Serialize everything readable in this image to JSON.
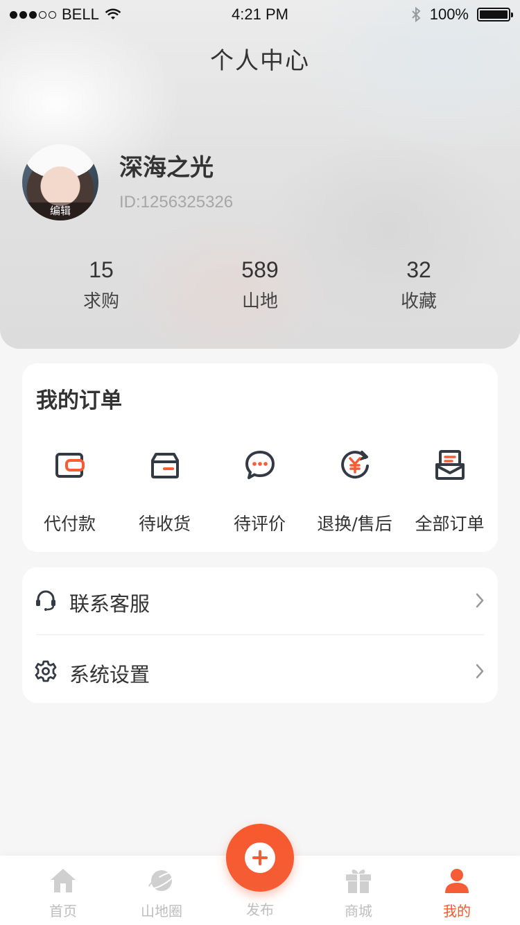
{
  "status_bar": {
    "carrier": "BELL",
    "time": "4:21 PM",
    "battery": "100%"
  },
  "page_title": "个人中心",
  "user": {
    "name": "深海之光",
    "id": "ID:1256325326",
    "avatar_edit": "编辑"
  },
  "stats": [
    {
      "value": "15",
      "label": "求购"
    },
    {
      "value": "589",
      "label": "山地"
    },
    {
      "value": "32",
      "label": "收藏"
    }
  ],
  "orders": {
    "title": "我的订单",
    "items": [
      {
        "label": "代付款",
        "icon": "wallet-icon"
      },
      {
        "label": "待收货",
        "icon": "package-icon"
      },
      {
        "label": "待评价",
        "icon": "comment-icon"
      },
      {
        "label": "退换/售后",
        "icon": "refund-icon"
      },
      {
        "label": "全部订单",
        "icon": "order-list-icon"
      }
    ]
  },
  "menu": [
    {
      "label": "联系客服",
      "icon": "headset-icon"
    },
    {
      "label": "系统设置",
      "icon": "gear-icon"
    }
  ],
  "tabbar": {
    "items": [
      {
        "label": "首页",
        "icon": "home-icon"
      },
      {
        "label": "山地圈",
        "icon": "planet-icon"
      },
      {
        "label": "发布",
        "icon": "plus-icon"
      },
      {
        "label": "商城",
        "icon": "gift-icon"
      },
      {
        "label": "我的",
        "icon": "user-icon"
      }
    ],
    "active": "我的"
  },
  "colors": {
    "accent": "#f45d35",
    "icon_dark": "#333a44",
    "inactive": "#bdbdbd"
  }
}
